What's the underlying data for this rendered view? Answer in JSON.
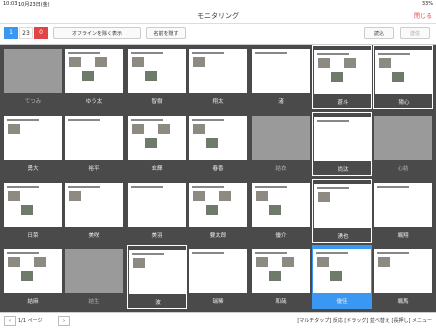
{
  "status": {
    "time": "10:03",
    "date": "10月23日(金)",
    "battery": "33%"
  },
  "header": {
    "title": "モニタリング",
    "close_label": "閉じる"
  },
  "toolbar": {
    "seg_a": "1",
    "seg_b": "23",
    "seg_c": "0",
    "offline_button": "オフラインを除く表示",
    "name_button": "名前を隠す",
    "import_button": "読込",
    "send_button": "送信"
  },
  "cells": [
    {
      "label": "てつみ",
      "gray": true
    },
    {
      "label": "ゆう太"
    },
    {
      "label": "智樹"
    },
    {
      "label": "翔太"
    },
    {
      "label": "渚"
    },
    {
      "label": "蒼斗",
      "selected": true
    },
    {
      "label": "陽心",
      "selected": true
    },
    {
      "label": "勇大"
    },
    {
      "label": "裕平"
    },
    {
      "label": "玄輝"
    },
    {
      "label": "春香"
    },
    {
      "label": "結衣",
      "gray": true
    },
    {
      "label": "尚汰",
      "selected": true
    },
    {
      "label": "心結",
      "gray": true
    },
    {
      "label": "日菜"
    },
    {
      "label": "美咲"
    },
    {
      "label": "美羽"
    },
    {
      "label": "要太郎"
    },
    {
      "label": "優介"
    },
    {
      "label": "湧也",
      "selected": true
    },
    {
      "label": "颯翔"
    },
    {
      "label": "結麻"
    },
    {
      "label": "結生",
      "gray": true
    },
    {
      "label": "波",
      "selected": true
    },
    {
      "label": "瑞稀"
    },
    {
      "label": "和哉"
    },
    {
      "label": "優佳",
      "active": true
    },
    {
      "label": "颯馬"
    }
  ],
  "bottom": {
    "page": "1/1 ページ",
    "tools": "[マルチタップ] 反応 [ドラッグ] 並べ替え [長押し] メニュー"
  },
  "colors": {
    "accent": "#3a98f3",
    "badge_red": "#e24545"
  }
}
